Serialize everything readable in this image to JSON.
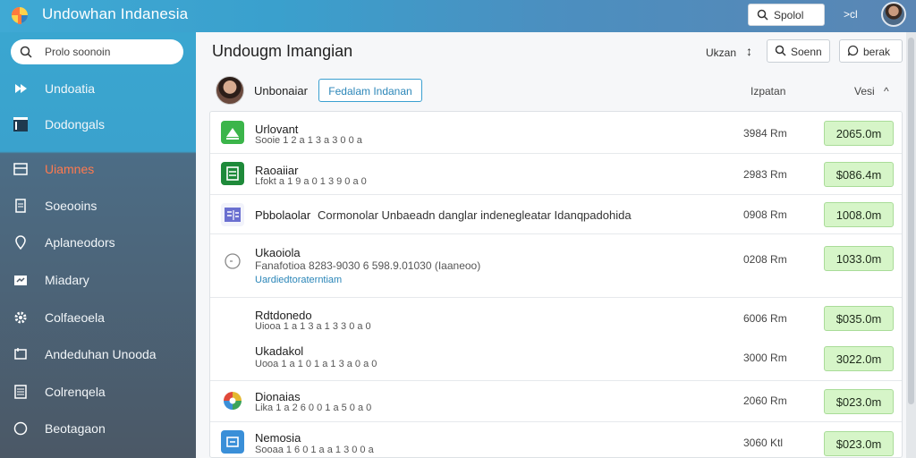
{
  "app": {
    "title": "Undowhan Indanesia"
  },
  "top": {
    "search_label": "Spolol",
    "cmd_label": ">cl"
  },
  "sidebar": {
    "search_placeholder": "Prolo soonoin",
    "items": [
      {
        "label": "Undoatia",
        "icon": "arrow-icon",
        "active": false
      },
      {
        "label": "Dodongals",
        "icon": "window-icon",
        "active": false
      },
      {
        "label": "Uiamnes",
        "icon": "inbox-icon",
        "active": true
      },
      {
        "label": "Soeooins",
        "icon": "document-icon",
        "active": false
      },
      {
        "label": "Aplaneodors",
        "icon": "location-icon",
        "active": false
      },
      {
        "label": "Miadary",
        "icon": "folder-icon",
        "active": false
      },
      {
        "label": "Colfaeoela",
        "icon": "gear-icon",
        "active": false
      },
      {
        "label": "Andeduhan Unooda",
        "icon": "export-icon",
        "active": false
      },
      {
        "label": "Colrenqela",
        "icon": "list-icon",
        "active": false
      },
      {
        "label": "Beotagaon",
        "icon": "circle-icon",
        "active": false
      }
    ]
  },
  "header": {
    "title": "Undougm Imangian",
    "sort_label": "Ukzan",
    "sort_symbol": "↕",
    "search_btn": "Soenn",
    "chat_btn": "berak"
  },
  "user_row": {
    "name": "Unbonaiar",
    "filter_btn": "Fedalam Indanan",
    "col_size": "Izpatan",
    "col_version": "Vesi",
    "col_version_arrow": "^"
  },
  "rows": [
    {
      "title": "Urlovant",
      "sub": "Sooie 1 2 a 1 3 a 3 0 0 a",
      "link": "",
      "size": "3984 Rm",
      "action": "2065.0m",
      "icon": "upload-icon",
      "color": "#3bb54a"
    },
    {
      "title": "Raoaiiar",
      "sub": "Lfokt a 1 9 a 0 1 3 9 0 a 0",
      "link": "",
      "size": "2983 Rm",
      "action": "$086.4m",
      "icon": "sheet-icon",
      "color": "#1e8a3a"
    },
    {
      "title": "Pbbolaolar",
      "sub": "Cormonolar Unbaeadn danglar indenegleatar Idanqpadohida",
      "link": "",
      "size": "0908 Rm",
      "action": "1008.0m",
      "icon": "form-icon",
      "color": "#6a6fd0"
    },
    {
      "title": "Ukaoiola",
      "sub": "Fanafotioa 8283-9030 6 598.9.01030 (Iaaneoo)",
      "link": "Uardiedtoraterntiam",
      "size": "0208 Rm",
      "action": "1033.0m",
      "icon": "clock-icon",
      "color": "#888888"
    },
    {
      "title": "Rdtdonedo",
      "sub": "Uiooa 1 a 1 3 a 1 3 3 0 a 0",
      "link": "",
      "size": "6006 Rm",
      "action": "$035.0m",
      "icon": "",
      "color": ""
    },
    {
      "title": "Ukadakol",
      "sub": "Uooa 1 a 1 0 1 a 1 3 a 0 a 0",
      "link": "",
      "size": "3000 Rm",
      "action": "3022.0m",
      "icon": "",
      "color": ""
    },
    {
      "title": "Dionaias",
      "sub": "Lika 1 a 2 6 0 0 1 a 5 0 a 0",
      "link": "",
      "size": "2060 Rm",
      "action": "$023.0m",
      "icon": "photos-icon",
      "color": "#e4b82f"
    },
    {
      "title": "Nemosia",
      "sub": "Sooaa 1 6 0 1 a a 1 3 0 0 a",
      "link": "",
      "size": "3060 Ktl",
      "action": "$023.0m",
      "icon": "drive-icon",
      "color": "#3a8fd8"
    }
  ]
}
